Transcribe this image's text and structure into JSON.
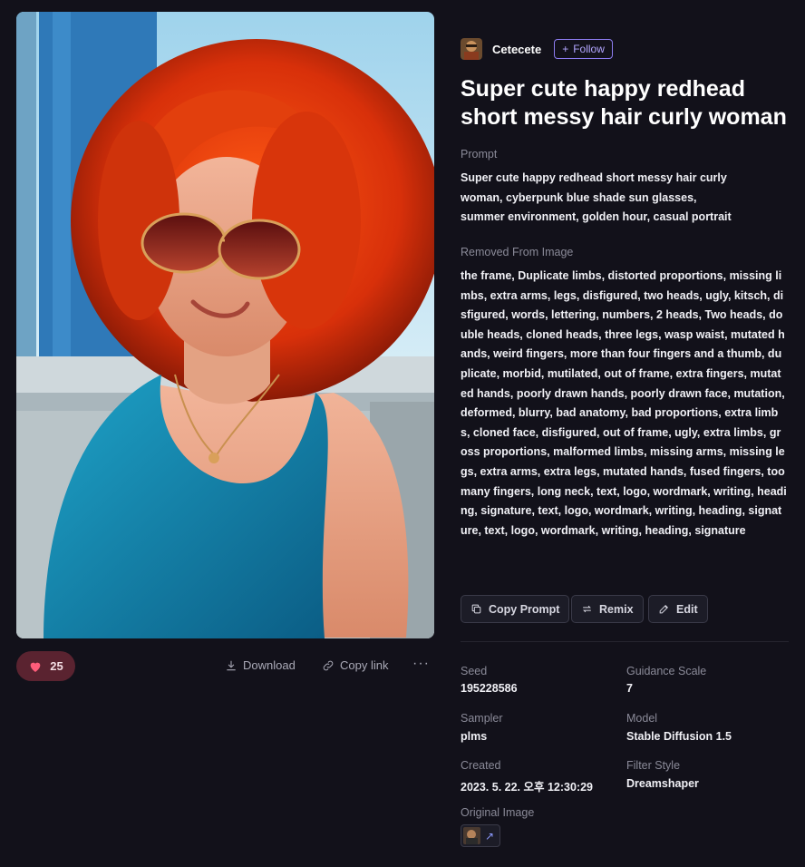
{
  "author": {
    "name": "Cetecete",
    "follow_label": "Follow",
    "avatar_icon": "user-avatar"
  },
  "title": "Super cute happy redhead short messy hair curly woman",
  "prompt": {
    "label": "Prompt",
    "text": "Super cute happy redhead short messy hair curly woman, cyberpunk blue shade sun glasses, summer environment, golden hour, casual portrait"
  },
  "removed": {
    "label": "Removed From Image",
    "text": "the frame, Duplicate limbs, distorted proportions, missing limbs, extra arms, legs, disfigured, two heads, ugly, kitsch, disfigured, words, lettering, numbers, 2 heads, Two heads, double heads, cloned heads, three legs, wasp waist, mutated hands, weird fingers, more than four fingers and a thumb, duplicate, morbid, mutilated, out of frame, extra fingers, mutated hands, poorly drawn hands, poorly drawn face, mutation, deformed, blurry, bad anatomy, bad proportions, extra limbs, cloned face, disfigured, out of frame, ugly, extra limbs, gross proportions, malformed limbs, missing arms, missing legs, extra arms, extra legs, mutated hands, fused fingers, too many fingers, long neck, text, logo, wordmark, writing, heading, signature, text, logo, wordmark, writing, heading, signature, text, logo, wordmark, writing, heading, signature"
  },
  "actions": {
    "copy_prompt": "Copy Prompt",
    "remix": "Remix",
    "edit": "Edit"
  },
  "image_actions": {
    "like_count": "25",
    "download": "Download",
    "copy_link": "Copy link",
    "more": "···"
  },
  "meta": {
    "seed_label": "Seed",
    "seed": "195228586",
    "guidance_label": "Guidance Scale",
    "guidance": "7",
    "sampler_label": "Sampler",
    "sampler": "plms",
    "model_label": "Model",
    "model": "Stable Diffusion 1.5",
    "created_label": "Created",
    "created": "2023. 5. 22. 오후 12:30:29",
    "filter_label": "Filter Style",
    "filter": "Dreamshaper",
    "original_label": "Original Image",
    "original_arrow": "↗"
  },
  "colors": {
    "background": "#12111a",
    "accent": "#8d7cf0",
    "like": "#ff5c7a"
  }
}
